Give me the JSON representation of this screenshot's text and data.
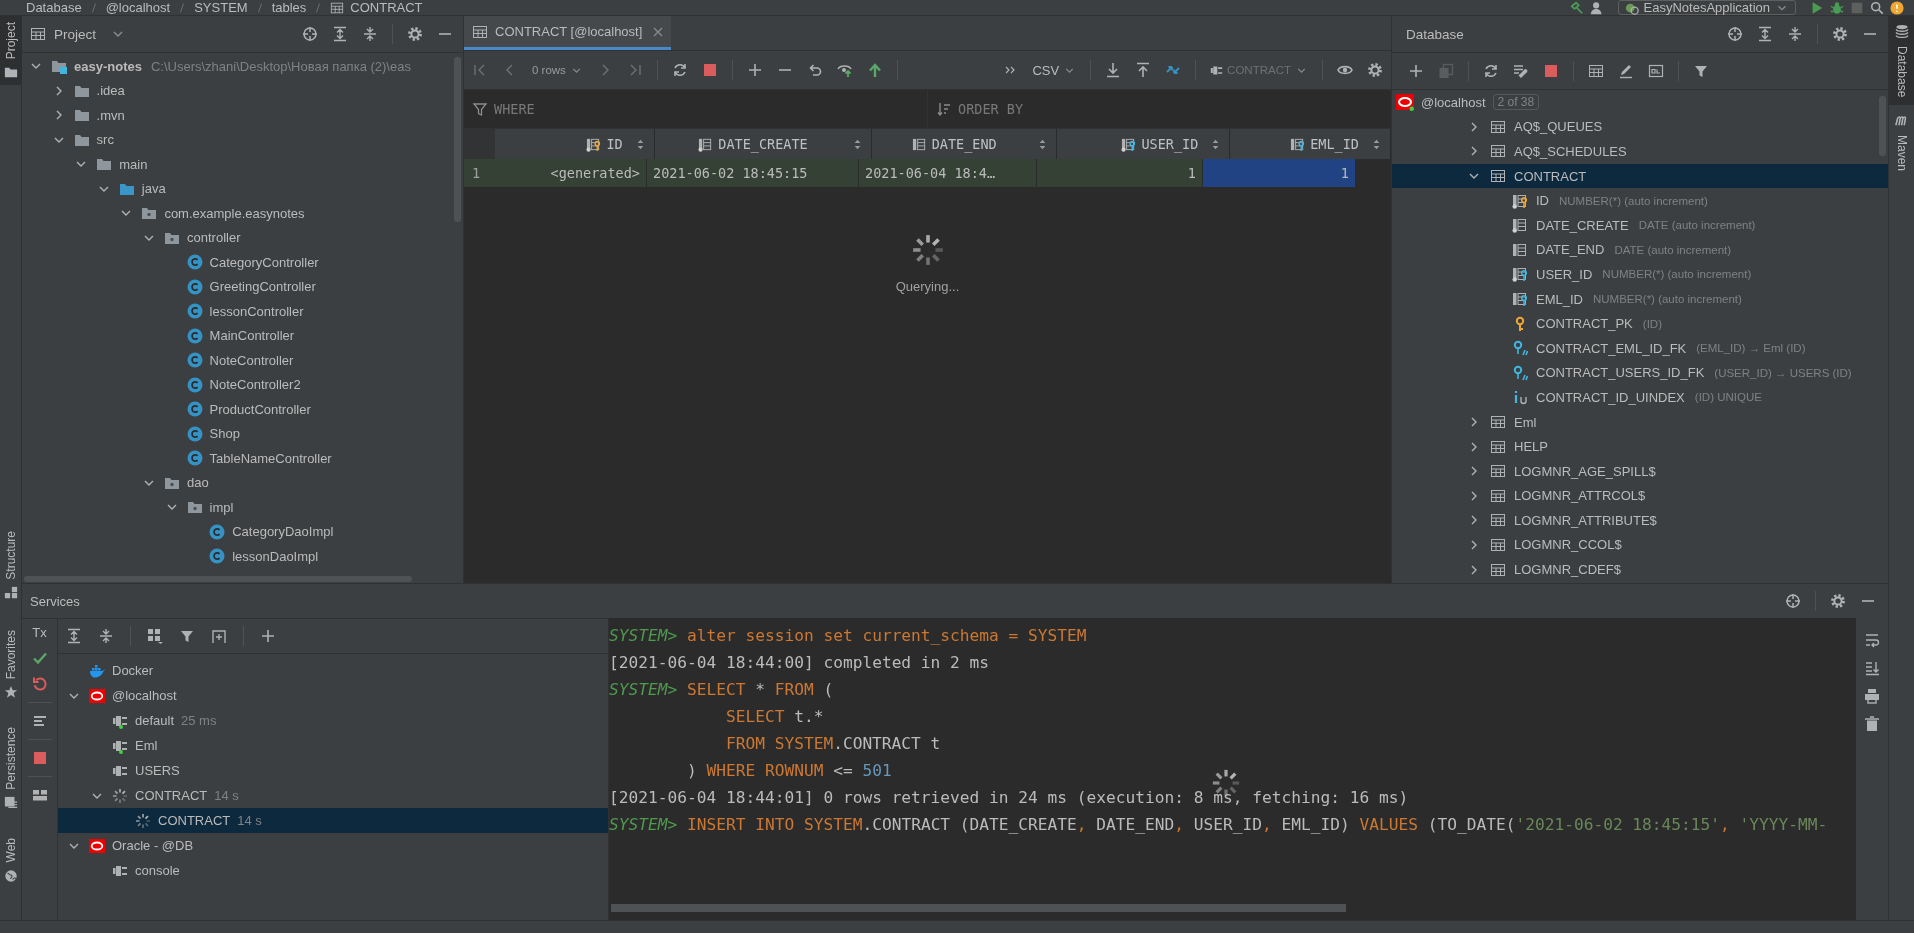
{
  "breadcrumbs": [
    {
      "label": "Database",
      "kind": "plain"
    },
    {
      "label": "@localhost",
      "kind": "plain"
    },
    {
      "label": "SYSTEM",
      "kind": "plain"
    },
    {
      "label": "tables",
      "kind": "plain"
    },
    {
      "label": "CONTRACT",
      "kind": "table"
    }
  ],
  "run_config": {
    "label": "EasyNotesApplication"
  },
  "left_strip": [
    {
      "label": "Project",
      "selected": true
    },
    {
      "label": "Structure",
      "selected": false
    },
    {
      "label": "Favorites",
      "selected": false
    },
    {
      "label": "Persistence",
      "selected": false
    },
    {
      "label": "Web",
      "selected": false
    }
  ],
  "right_strip": [
    {
      "label": "Database",
      "selected": true
    },
    {
      "label": "Maven",
      "selected": false
    }
  ],
  "project": {
    "title": "Project",
    "tree": [
      {
        "label": "easy-notes",
        "path": "C:\\Users\\zhani\\Desktop\\Новая папка (2)\\eas",
        "kind": "module",
        "expanded": true,
        "selected": false,
        "children": [
          {
            "label": ".idea",
            "kind": "folder",
            "expanded": false,
            "selected": false
          },
          {
            "label": ".mvn",
            "kind": "folder",
            "expanded": false,
            "selected": false
          },
          {
            "label": "src",
            "kind": "folder",
            "expanded": true,
            "selected": false,
            "children": [
              {
                "label": "main",
                "kind": "folder",
                "expanded": true,
                "selected": false,
                "children": [
                  {
                    "label": "java",
                    "kind": "source-folder",
                    "expanded": true,
                    "selected": false,
                    "children": [
                      {
                        "label": "com.example.easynotes",
                        "kind": "package",
                        "expanded": true,
                        "selected": false,
                        "children": [
                          {
                            "label": "controller",
                            "kind": "package",
                            "expanded": true,
                            "selected": false,
                            "children": [
                              {
                                "label": "CategoryController",
                                "kind": "class",
                                "selected": false
                              },
                              {
                                "label": "GreetingController",
                                "kind": "class",
                                "selected": false
                              },
                              {
                                "label": "lessonController",
                                "kind": "class",
                                "selected": false
                              },
                              {
                                "label": "MainController",
                                "kind": "class",
                                "selected": false
                              },
                              {
                                "label": "NoteController",
                                "kind": "class",
                                "selected": false
                              },
                              {
                                "label": "NoteController2",
                                "kind": "class",
                                "selected": false
                              },
                              {
                                "label": "ProductController",
                                "kind": "class",
                                "selected": false
                              },
                              {
                                "label": "Shop",
                                "kind": "class",
                                "selected": false
                              },
                              {
                                "label": "TableNameController",
                                "kind": "class",
                                "selected": false
                              }
                            ]
                          },
                          {
                            "label": "dao",
                            "kind": "package",
                            "expanded": true,
                            "selected": false,
                            "children": [
                              {
                                "label": "impl",
                                "kind": "package",
                                "expanded": true,
                                "selected": false,
                                "children": [
                                  {
                                    "label": "CategoryDaoImpl",
                                    "kind": "class",
                                    "selected": false
                                  },
                                  {
                                    "label": "lessonDaoImpl",
                                    "kind": "class",
                                    "selected": false
                                  }
                                ]
                              }
                            ]
                          }
                        ]
                      }
                    ]
                  }
                ]
              }
            ]
          }
        ]
      }
    ]
  },
  "editor": {
    "tabs": [
      {
        "label": "CONTRACT [@localhost]",
        "selected": true
      }
    ],
    "toolbar": {
      "rows": "0 rows",
      "format": "CSV",
      "session": "CONTRACT"
    },
    "filter": {
      "where": {
        "placeholder": "WHERE"
      },
      "order_by": {
        "placeholder": "ORDER BY"
      }
    },
    "grid": {
      "columns": [
        {
          "name": "ID",
          "kind": "pk-column",
          "required": true
        },
        {
          "name": "DATE_CREATE",
          "kind": "column",
          "required": true
        },
        {
          "name": "DATE_END",
          "kind": "column",
          "required": false
        },
        {
          "name": "USER_ID",
          "kind": "fk-column",
          "required": true
        },
        {
          "name": "EML_ID",
          "kind": "fk-column",
          "required": false
        }
      ],
      "rows": [
        {
          "number": "1",
          "pending": true,
          "cells": [
            {
              "value": "<generated>",
              "selected": false
            },
            {
              "value": "2021-06-02 18:45:15",
              "selected": false
            },
            {
              "value": "2021-06-04 18:4…",
              "selected": false
            },
            {
              "value": "1",
              "selected": false
            },
            {
              "value": "1",
              "selected": true
            }
          ]
        }
      ]
    },
    "status": "Querying..."
  },
  "database": {
    "title": "Database",
    "root": {
      "label": "@localhost",
      "badge": "2 of 38",
      "selected": false
    },
    "tables": [
      {
        "name": "AQ$_QUEUES",
        "expanded": false,
        "selected": false
      },
      {
        "name": "AQ$_SCHEDULES",
        "expanded": false,
        "selected": false
      },
      {
        "name": "CONTRACT",
        "expanded": true,
        "selected": true,
        "children": [
          {
            "kind": "pk-column",
            "required": true,
            "name": "ID",
            "detail": "NUMBER(*) (auto increment)",
            "selected": false
          },
          {
            "kind": "column",
            "required": true,
            "name": "DATE_CREATE",
            "detail": "DATE (auto increment)",
            "selected": false
          },
          {
            "kind": "column",
            "required": false,
            "name": "DATE_END",
            "detail": "DATE (auto increment)",
            "selected": false
          },
          {
            "kind": "fk-column",
            "required": true,
            "name": "USER_ID",
            "detail": "NUMBER(*) (auto increment)",
            "selected": false
          },
          {
            "kind": "fk-column",
            "required": false,
            "name": "EML_ID",
            "detail": "NUMBER(*) (auto increment)",
            "selected": false
          },
          {
            "kind": "primary-key",
            "name": "CONTRACT_PK",
            "detail": "(ID)",
            "selected": false
          },
          {
            "kind": "foreign-key",
            "name": "CONTRACT_EML_ID_FK",
            "detail": "(EML_ID) → Eml (ID)",
            "selected": false
          },
          {
            "kind": "foreign-key",
            "name": "CONTRACT_USERS_ID_FK",
            "detail": "(USER_ID) → USERS (ID)",
            "selected": false
          },
          {
            "kind": "index",
            "name": "CONTRACT_ID_UINDEX",
            "detail": "(ID) UNIQUE",
            "selected": false
          }
        ]
      },
      {
        "name": "Eml",
        "expanded": false,
        "selected": false
      },
      {
        "name": "HELP",
        "expanded": false,
        "selected": false
      },
      {
        "name": "LOGMNR_AGE_SPILL$",
        "expanded": false,
        "selected": false
      },
      {
        "name": "LOGMNR_ATTRCOL$",
        "expanded": false,
        "selected": false
      },
      {
        "name": "LOGMNR_ATTRIBUTE$",
        "expanded": false,
        "selected": false
      },
      {
        "name": "LOGMNR_CCOL$",
        "expanded": false,
        "selected": false
      },
      {
        "name": "LOGMNR_CDEF$",
        "expanded": false,
        "selected": false
      }
    ]
  },
  "services": {
    "title": "Services",
    "tx": "Tx",
    "tree": [
      {
        "label": "Docker",
        "kind": "docker",
        "selected": false
      },
      {
        "label": "@localhost",
        "kind": "oracle",
        "expanded": true,
        "selected": false,
        "children": [
          {
            "label": "default",
            "time": "25 ms",
            "kind": "session",
            "connected": true,
            "selected": false
          },
          {
            "label": "Eml",
            "kind": "session",
            "connected": true,
            "selected": false
          },
          {
            "label": "USERS",
            "kind": "session",
            "connected": false,
            "selected": false
          },
          {
            "label": "CONTRACT",
            "time": "14 s",
            "kind": "running",
            "expanded": true,
            "selected": false,
            "children": [
              {
                "label": "CONTRACT",
                "time": "14 s",
                "kind": "running",
                "selected": true
              }
            ]
          }
        ]
      },
      {
        "label": "Oracle - @DB",
        "kind": "oracle",
        "expanded": true,
        "selected": false,
        "children": [
          {
            "label": "console",
            "kind": "session",
            "connected": false,
            "selected": false
          }
        ]
      }
    ]
  },
  "console": {
    "lines": [
      {
        "kind": "statement",
        "tokens": [
          {
            "kind": "prompt",
            "text": "SYSTEM> "
          },
          {
            "kind": "kw",
            "text": "alter session set current_schema = SYSTEM"
          }
        ]
      },
      {
        "kind": "output",
        "tokens": [
          {
            "kind": "plain",
            "text": "[2021-06-04 18:44:00] completed in 2 ms"
          }
        ]
      },
      {
        "kind": "statement",
        "tokens": [
          {
            "kind": "prompt",
            "text": "SYSTEM> "
          },
          {
            "kind": "kw",
            "text": "SELECT"
          },
          {
            "kind": "plain",
            "text": " * "
          },
          {
            "kind": "kw",
            "text": "FROM"
          },
          {
            "kind": "plain",
            "text": " ("
          }
        ]
      },
      {
        "kind": "nested",
        "tokens": [
          {
            "kind": "kw",
            "text": "SELECT"
          },
          {
            "kind": "plain",
            "text": " t.*"
          }
        ]
      },
      {
        "kind": "nested",
        "tokens": [
          {
            "kind": "kw",
            "text": "FROM SYSTEM"
          },
          {
            "kind": "plain",
            "text": ".CONTRACT t"
          }
        ]
      },
      {
        "kind": "closing",
        "tokens": [
          {
            "kind": "plain",
            "text": ") "
          },
          {
            "kind": "kw",
            "text": "WHERE ROWNUM"
          },
          {
            "kind": "plain",
            "text": " <= "
          },
          {
            "kind": "num",
            "text": "501"
          }
        ]
      },
      {
        "kind": "output",
        "tokens": [
          {
            "kind": "plain",
            "text": "[2021-06-04 18:44:01] 0 rows retrieved in 24 ms (execution: 8 ms, fetching: 16 ms)"
          }
        ]
      },
      {
        "kind": "statement",
        "tokens": [
          {
            "kind": "prompt",
            "text": "SYSTEM> "
          },
          {
            "kind": "kw",
            "text": "INSERT INTO SYSTEM"
          },
          {
            "kind": "plain",
            "text": ".CONTRACT (DATE_CREATE"
          },
          {
            "kind": "kw",
            "text": ","
          },
          {
            "kind": "plain",
            "text": " DATE_END"
          },
          {
            "kind": "kw",
            "text": ","
          },
          {
            "kind": "plain",
            "text": " USER_ID"
          },
          {
            "kind": "kw",
            "text": ","
          },
          {
            "kind": "plain",
            "text": " EML_ID) "
          },
          {
            "kind": "kw",
            "text": "VALUES"
          },
          {
            "kind": "plain",
            "text": " (TO_DATE("
          },
          {
            "kind": "str",
            "text": "'2021-06-02 18:45:15'"
          },
          {
            "kind": "kw",
            "text": ","
          },
          {
            "kind": "str",
            "text": " 'YYYY-MM-"
          }
        ]
      }
    ]
  }
}
